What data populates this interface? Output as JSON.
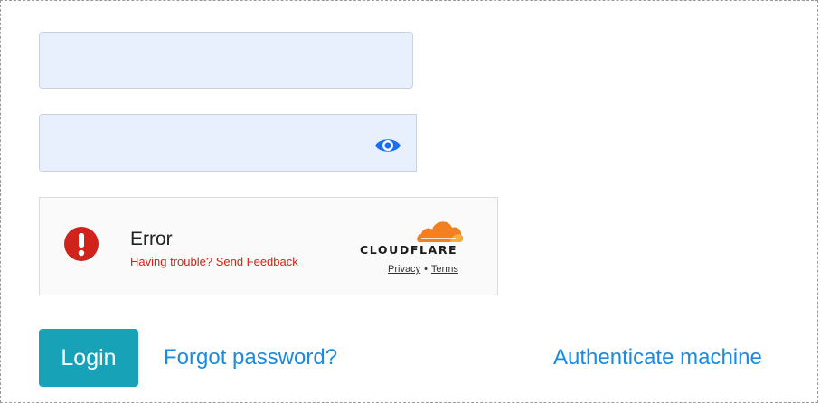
{
  "form": {
    "username": {
      "value": "",
      "placeholder": ""
    },
    "password": {
      "value": "",
      "placeholder": ""
    },
    "show_password_icon": "eye-icon"
  },
  "captcha": {
    "status_title": "Error",
    "trouble_text": "Having trouble?",
    "feedback_link": "Send Feedback",
    "brand": "CLOUDFLARE",
    "privacy_link": "Privacy",
    "separator": "•",
    "terms_link": "Terms",
    "error_icon": "exclamation-circle-icon",
    "brand_icon": "cloudflare-cloud-icon"
  },
  "actions": {
    "login_label": "Login",
    "forgot_password_label": "Forgot password?",
    "authenticate_machine_label": "Authenticate machine"
  },
  "colors": {
    "login_button": "#17a2b8",
    "link": "#1a8be0",
    "error": "#d0231b",
    "input_fill": "#e8f0fe",
    "eye_icon": "#1a6ff0",
    "cloudflare_orange": "#f38020"
  }
}
